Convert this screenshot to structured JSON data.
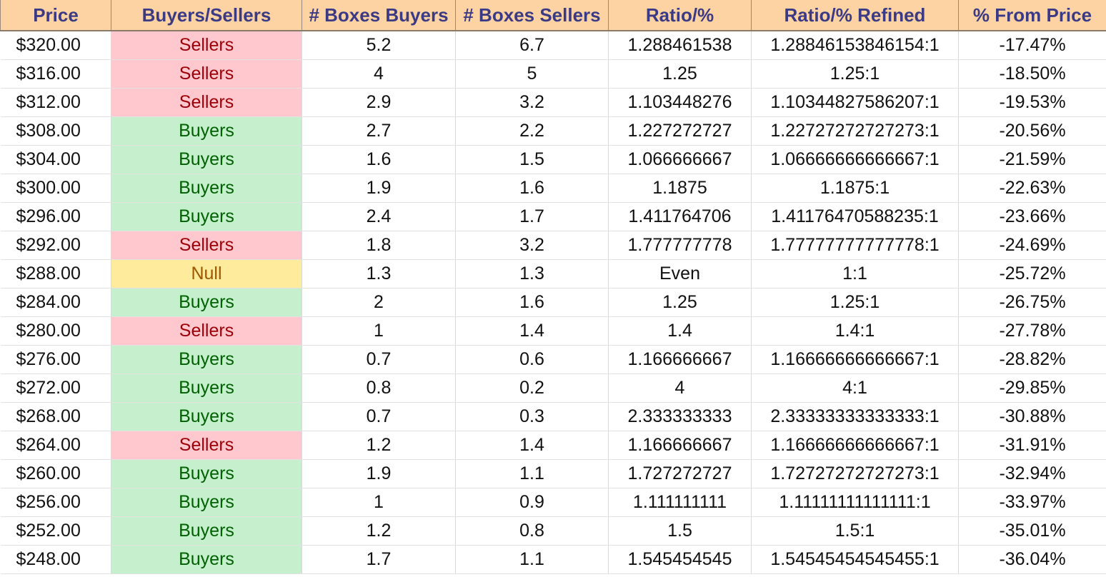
{
  "headers": {
    "price": "Price",
    "side": "Buyers/Sellers",
    "boxes_buyers": "# Boxes Buyers",
    "boxes_sellers": "# Boxes Sellers",
    "ratio": "Ratio/%",
    "ratio_refined": "Ratio/% Refined",
    "pct_from_price": "% From Price"
  },
  "side_colors": {
    "Sellers": {
      "fill": "#ffc7ce",
      "text": "#9c0006"
    },
    "Buyers": {
      "fill": "#c6efce",
      "text": "#006100"
    },
    "Null": {
      "fill": "#ffeb9c",
      "text": "#9c5700"
    }
  },
  "rows": [
    {
      "price": "$320.00",
      "side": "Sellers",
      "boxes_buyers": "5.2",
      "boxes_sellers": "6.7",
      "ratio": "1.288461538",
      "ratio_refined": "1.28846153846154:1",
      "pct_from_price": "-17.47%"
    },
    {
      "price": "$316.00",
      "side": "Sellers",
      "boxes_buyers": "4",
      "boxes_sellers": "5",
      "ratio": "1.25",
      "ratio_refined": "1.25:1",
      "pct_from_price": "-18.50%"
    },
    {
      "price": "$312.00",
      "side": "Sellers",
      "boxes_buyers": "2.9",
      "boxes_sellers": "3.2",
      "ratio": "1.103448276",
      "ratio_refined": "1.10344827586207:1",
      "pct_from_price": "-19.53%"
    },
    {
      "price": "$308.00",
      "side": "Buyers",
      "boxes_buyers": "2.7",
      "boxes_sellers": "2.2",
      "ratio": "1.227272727",
      "ratio_refined": "1.22727272727273:1",
      "pct_from_price": "-20.56%"
    },
    {
      "price": "$304.00",
      "side": "Buyers",
      "boxes_buyers": "1.6",
      "boxes_sellers": "1.5",
      "ratio": "1.066666667",
      "ratio_refined": "1.06666666666667:1",
      "pct_from_price": "-21.59%"
    },
    {
      "price": "$300.00",
      "side": "Buyers",
      "boxes_buyers": "1.9",
      "boxes_sellers": "1.6",
      "ratio": "1.1875",
      "ratio_refined": "1.1875:1",
      "pct_from_price": "-22.63%"
    },
    {
      "price": "$296.00",
      "side": "Buyers",
      "boxes_buyers": "2.4",
      "boxes_sellers": "1.7",
      "ratio": "1.411764706",
      "ratio_refined": "1.41176470588235:1",
      "pct_from_price": "-23.66%"
    },
    {
      "price": "$292.00",
      "side": "Sellers",
      "boxes_buyers": "1.8",
      "boxes_sellers": "3.2",
      "ratio": "1.777777778",
      "ratio_refined": "1.77777777777778:1",
      "pct_from_price": "-24.69%"
    },
    {
      "price": "$288.00",
      "side": "Null",
      "boxes_buyers": "1.3",
      "boxes_sellers": "1.3",
      "ratio": "Even",
      "ratio_refined": "1:1",
      "pct_from_price": "-25.72%"
    },
    {
      "price": "$284.00",
      "side": "Buyers",
      "boxes_buyers": "2",
      "boxes_sellers": "1.6",
      "ratio": "1.25",
      "ratio_refined": "1.25:1",
      "pct_from_price": "-26.75%"
    },
    {
      "price": "$280.00",
      "side": "Sellers",
      "boxes_buyers": "1",
      "boxes_sellers": "1.4",
      "ratio": "1.4",
      "ratio_refined": "1.4:1",
      "pct_from_price": "-27.78%"
    },
    {
      "price": "$276.00",
      "side": "Buyers",
      "boxes_buyers": "0.7",
      "boxes_sellers": "0.6",
      "ratio": "1.166666667",
      "ratio_refined": "1.16666666666667:1",
      "pct_from_price": "-28.82%"
    },
    {
      "price": "$272.00",
      "side": "Buyers",
      "boxes_buyers": "0.8",
      "boxes_sellers": "0.2",
      "ratio": "4",
      "ratio_refined": "4:1",
      "pct_from_price": "-29.85%"
    },
    {
      "price": "$268.00",
      "side": "Buyers",
      "boxes_buyers": "0.7",
      "boxes_sellers": "0.3",
      "ratio": "2.333333333",
      "ratio_refined": "2.33333333333333:1",
      "pct_from_price": "-30.88%"
    },
    {
      "price": "$264.00",
      "side": "Sellers",
      "boxes_buyers": "1.2",
      "boxes_sellers": "1.4",
      "ratio": "1.166666667",
      "ratio_refined": "1.16666666666667:1",
      "pct_from_price": "-31.91%"
    },
    {
      "price": "$260.00",
      "side": "Buyers",
      "boxes_buyers": "1.9",
      "boxes_sellers": "1.1",
      "ratio": "1.727272727",
      "ratio_refined": "1.72727272727273:1",
      "pct_from_price": "-32.94%"
    },
    {
      "price": "$256.00",
      "side": "Buyers",
      "boxes_buyers": "1",
      "boxes_sellers": "0.9",
      "ratio": "1.111111111",
      "ratio_refined": "1.11111111111111:1",
      "pct_from_price": "-33.97%"
    },
    {
      "price": "$252.00",
      "side": "Buyers",
      "boxes_buyers": "1.2",
      "boxes_sellers": "0.8",
      "ratio": "1.5",
      "ratio_refined": "1.5:1",
      "pct_from_price": "-35.01%"
    },
    {
      "price": "$248.00",
      "side": "Buyers",
      "boxes_buyers": "1.7",
      "boxes_sellers": "1.1",
      "ratio": "1.545454545",
      "ratio_refined": "1.54545454545455:1",
      "pct_from_price": "-36.04%"
    }
  ]
}
